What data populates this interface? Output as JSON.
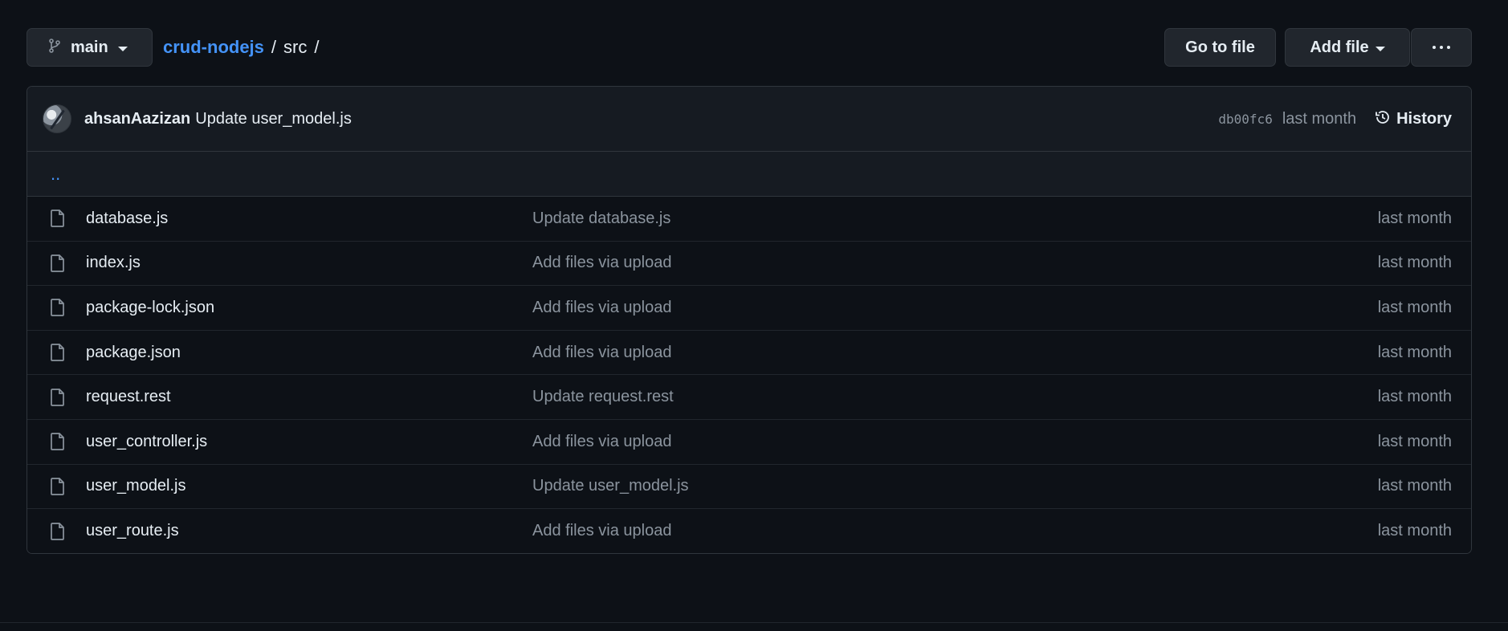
{
  "toolbar": {
    "branch": "main",
    "repo": "crud-nodejs",
    "separator": "/",
    "folder": "src",
    "trailing_separator": "/",
    "go_to_file": "Go to file",
    "add_file": "Add file"
  },
  "commit": {
    "author": "ahsanAazizan",
    "message": "Update user_model.js",
    "sha": "db00fc6",
    "time": "last month",
    "history": "History"
  },
  "parent_dir": "..",
  "files": [
    {
      "name": "database.js",
      "commit": "Update database.js",
      "time": "last month"
    },
    {
      "name": "index.js",
      "commit": "Add files via upload",
      "time": "last month"
    },
    {
      "name": "package-lock.json",
      "commit": "Add files via upload",
      "time": "last month"
    },
    {
      "name": "package.json",
      "commit": "Add files via upload",
      "time": "last month"
    },
    {
      "name": "request.rest",
      "commit": "Update request.rest",
      "time": "last month"
    },
    {
      "name": "user_controller.js",
      "commit": "Add files via upload",
      "time": "last month"
    },
    {
      "name": "user_model.js",
      "commit": "Update user_model.js",
      "time": "last month"
    },
    {
      "name": "user_route.js",
      "commit": "Add files via upload",
      "time": "last month"
    }
  ],
  "icons": {
    "branch": "git-branch-icon",
    "caret": "chevron-down-icon",
    "more": "kebab-horizontal-icon",
    "history": "history-clock-icon",
    "file": "file-icon"
  },
  "colors": {
    "background": "#0d1117",
    "panel": "#161b22",
    "border": "#30363d",
    "link": "#4493f8",
    "text": "#e6edf3",
    "muted": "#8b949e"
  }
}
